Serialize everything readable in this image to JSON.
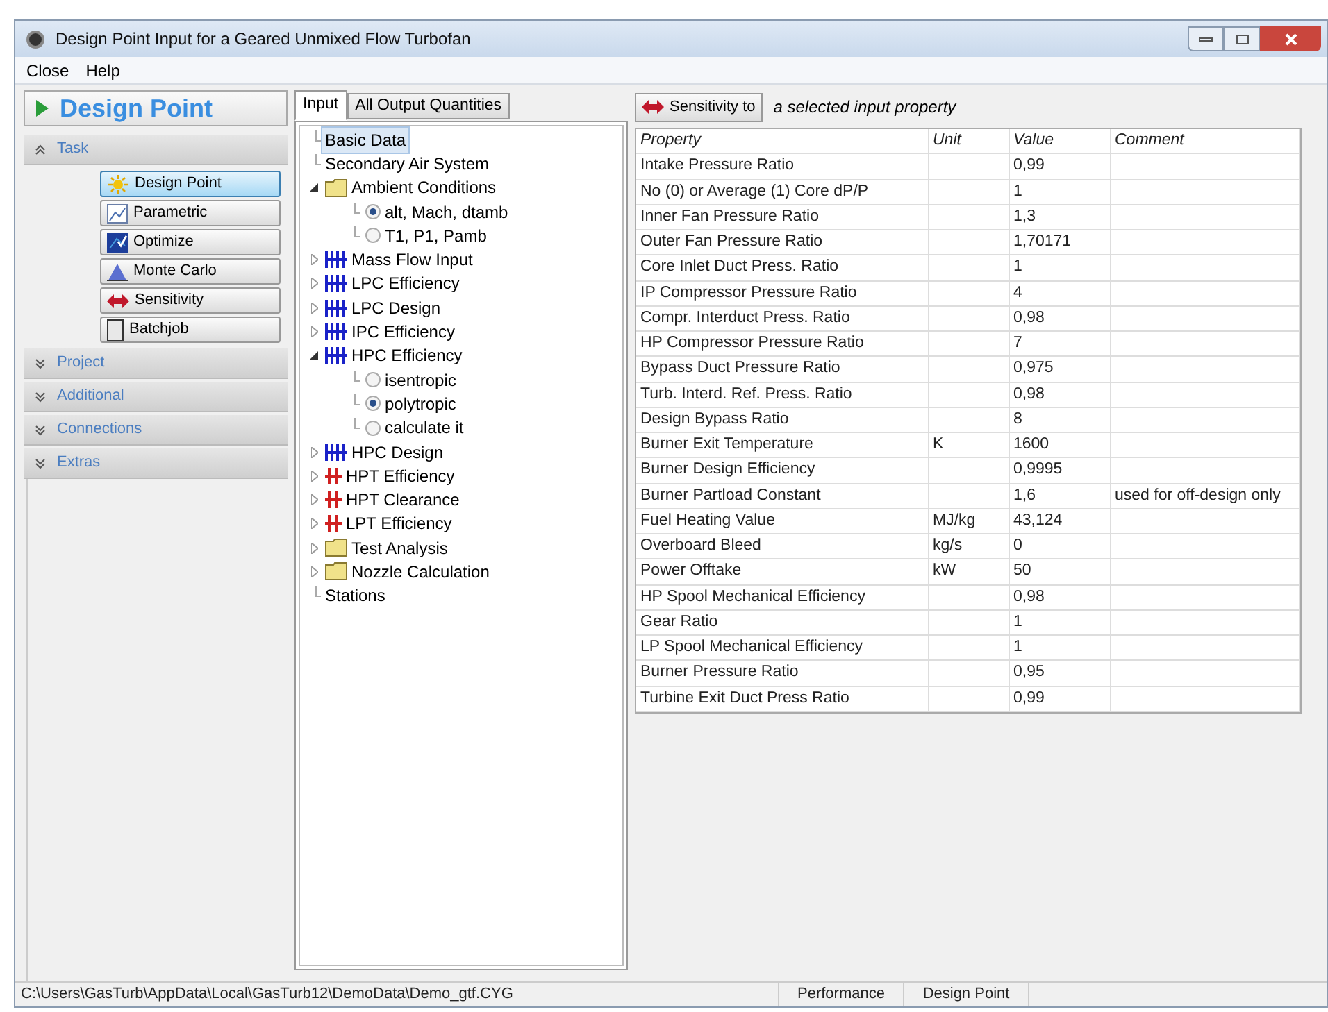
{
  "window": {
    "title": "Design Point Input for a Geared Unmixed Flow Turbofan"
  },
  "menu": [
    "Close",
    "Help"
  ],
  "mode_header": "Design Point",
  "sections": [
    {
      "label": "Task",
      "expanded": true,
      "items": [
        {
          "label": "Design Point",
          "kind": "sun",
          "selected": true
        },
        {
          "label": "Parametric",
          "kind": "chart",
          "selected": false
        },
        {
          "label": "Optimize",
          "kind": "optimize",
          "selected": false
        },
        {
          "label": "Monte Carlo",
          "kind": "montecarlo",
          "selected": false
        },
        {
          "label": "Sensitivity",
          "kind": "arrows",
          "selected": false
        },
        {
          "label": "Batchjob",
          "kind": "page",
          "selected": false
        }
      ]
    },
    {
      "label": "Project",
      "expanded": false
    },
    {
      "label": "Additional",
      "expanded": false
    },
    {
      "label": "Connections",
      "expanded": false
    },
    {
      "label": "Extras",
      "expanded": false
    }
  ],
  "tabs": [
    {
      "label": "Input",
      "selected": true
    },
    {
      "label": "All Output Quantities",
      "selected": false
    }
  ],
  "tree": [
    {
      "label": "Basic Data",
      "kind": "leaf",
      "selected": true
    },
    {
      "label": "Secondary Air System",
      "kind": "leaf",
      "selected": false
    },
    {
      "label": "Ambient Conditions",
      "kind": "folder",
      "expanded": true,
      "selected": false,
      "children": [
        {
          "label": "alt, Mach, dtamb",
          "kind": "radio",
          "checked": true,
          "selected": false
        },
        {
          "label": "T1, P1, Pamb",
          "kind": "radio",
          "checked": false,
          "selected": false
        }
      ]
    },
    {
      "label": "Mass Flow Input",
      "kind": "compressor",
      "expanded": false,
      "selected": false
    },
    {
      "label": "LPC Efficiency",
      "kind": "compressor",
      "expanded": false,
      "selected": false
    },
    {
      "label": "LPC Design",
      "kind": "compressor",
      "expanded": false,
      "selected": false
    },
    {
      "label": "IPC Efficiency",
      "kind": "compressor",
      "expanded": false,
      "selected": false
    },
    {
      "label": "HPC Efficiency",
      "kind": "compressor",
      "expanded": true,
      "selected": false,
      "children": [
        {
          "label": "isentropic",
          "kind": "radio",
          "checked": false,
          "selected": false
        },
        {
          "label": "polytropic",
          "kind": "radio",
          "checked": true,
          "selected": false
        },
        {
          "label": "calculate it",
          "kind": "radio",
          "checked": false,
          "selected": false
        }
      ]
    },
    {
      "label": "HPC Design",
      "kind": "compressor",
      "expanded": false,
      "selected": false
    },
    {
      "label": "HPT Efficiency",
      "kind": "turbine",
      "expanded": false,
      "selected": false
    },
    {
      "label": "HPT Clearance",
      "kind": "turbine",
      "expanded": false,
      "selected": false
    },
    {
      "label": "LPT Efficiency",
      "kind": "turbine",
      "expanded": false,
      "selected": false
    },
    {
      "label": "Test Analysis",
      "kind": "folder",
      "expanded": false,
      "selected": false
    },
    {
      "label": "Nozzle Calculation",
      "kind": "folder",
      "expanded": false,
      "selected": false
    },
    {
      "label": "Stations",
      "kind": "leaf",
      "selected": false
    }
  ],
  "sensitivity": {
    "button": "Sensitivity to",
    "hint": "a selected input property"
  },
  "table": {
    "columns": [
      "Property",
      "Unit",
      "Value",
      "Comment"
    ],
    "rows": [
      [
        "Intake Pressure Ratio",
        "",
        "0,99",
        ""
      ],
      [
        "No (0) or Average (1) Core dP/P",
        "",
        "1",
        ""
      ],
      [
        "Inner Fan Pressure Ratio",
        "",
        "1,3",
        ""
      ],
      [
        "Outer Fan Pressure Ratio",
        "",
        "1,70171",
        ""
      ],
      [
        "Core Inlet Duct Press. Ratio",
        "",
        "1",
        ""
      ],
      [
        "IP Compressor Pressure Ratio",
        "",
        "4",
        ""
      ],
      [
        "Compr. Interduct Press. Ratio",
        "",
        "0,98",
        ""
      ],
      [
        "HP Compressor Pressure Ratio",
        "",
        "7",
        ""
      ],
      [
        "Bypass Duct Pressure Ratio",
        "",
        "0,975",
        ""
      ],
      [
        "Turb. Interd. Ref. Press. Ratio",
        "",
        "0,98",
        ""
      ],
      [
        "Design Bypass Ratio",
        "",
        "8",
        ""
      ],
      [
        "Burner Exit Temperature",
        "K",
        "1600",
        ""
      ],
      [
        "Burner Design Efficiency",
        "",
        "0,9995",
        ""
      ],
      [
        "Burner Partload Constant",
        "",
        "1,6",
        "used for off-design only"
      ],
      [
        "Fuel Heating Value",
        "MJ/kg",
        "43,124",
        ""
      ],
      [
        "Overboard Bleed",
        "kg/s",
        "0",
        ""
      ],
      [
        "Power Offtake",
        "kW",
        "50",
        ""
      ],
      [
        "HP Spool Mechanical Efficiency",
        "",
        "0,98",
        ""
      ],
      [
        "Gear Ratio",
        "",
        "1",
        ""
      ],
      [
        "LP Spool Mechanical Efficiency",
        "",
        "1",
        ""
      ],
      [
        "Burner Pressure Ratio",
        "",
        "0,95",
        ""
      ],
      [
        "Turbine Exit Duct Press Ratio",
        "",
        "0,99",
        ""
      ]
    ]
  },
  "status_bar": [
    "C:\\Users\\GasTurb\\AppData\\Local\\GasTurb12\\DemoData\\Demo_gtf.CYG",
    "Performance",
    "Design Point"
  ]
}
